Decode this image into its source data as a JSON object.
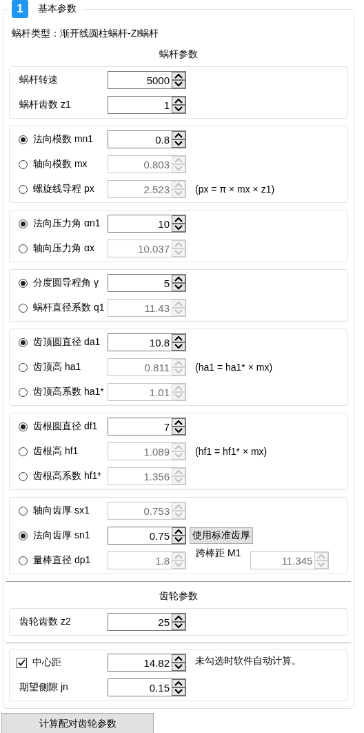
{
  "header": {
    "badge": "1",
    "title": "基本参数"
  },
  "worm_type": "蜗杆类型：渐开线圆柱蜗杆-ZI蜗杆",
  "sections": [
    {
      "title": "蜗杆参数",
      "groups": [
        {
          "rows": [
            {
              "kind": "plain",
              "label": "蜗杆转速",
              "value": "5000",
              "disabled": false
            },
            {
              "kind": "plain",
              "label": "蜗杆齿数 z1",
              "value": "1",
              "disabled": false
            }
          ]
        },
        {
          "rows": [
            {
              "kind": "radio",
              "selected": true,
              "label": "法向模数 mn1",
              "value": "0.8",
              "disabled": false
            },
            {
              "kind": "radio",
              "selected": false,
              "label": "轴向模数 mx",
              "value": "0.803",
              "disabled": true
            },
            {
              "kind": "radio",
              "selected": false,
              "label": "螺旋线导程 px",
              "value": "2.523",
              "disabled": true,
              "note": "(px = π × mx × z1)"
            }
          ]
        },
        {
          "rows": [
            {
              "kind": "radio",
              "selected": true,
              "label": "法向压力角 αn1",
              "value": "10",
              "disabled": false
            },
            {
              "kind": "radio",
              "selected": false,
              "label": "轴向压力角 αx",
              "value": "10.037",
              "disabled": true
            }
          ]
        },
        {
          "rows": [
            {
              "kind": "radio",
              "selected": true,
              "label": "分度圆导程角 γ",
              "value": "5",
              "disabled": false
            },
            {
              "kind": "radio",
              "selected": false,
              "label": "蜗杆直径系数 q1",
              "value": "11.43",
              "disabled": true
            }
          ]
        },
        {
          "rows": [
            {
              "kind": "radio",
              "selected": true,
              "label": "齿顶圆直径 da1",
              "value": "10.8",
              "disabled": false
            },
            {
              "kind": "radio",
              "selected": false,
              "label": "齿顶高 ha1",
              "value": "0.811",
              "disabled": true,
              "note": "(ha1 = ha1* × mx)"
            },
            {
              "kind": "radio",
              "selected": false,
              "label": "齿顶高系数 ha1*",
              "value": "1.01",
              "disabled": true
            }
          ]
        },
        {
          "rows": [
            {
              "kind": "radio",
              "selected": true,
              "label": "齿根圆直径 df1",
              "value": "7",
              "disabled": false
            },
            {
              "kind": "radio",
              "selected": false,
              "label": "齿根高 hf1",
              "value": "1.089",
              "disabled": true,
              "note": "(hf1 = hf1* × mx)"
            },
            {
              "kind": "radio",
              "selected": false,
              "label": "齿根高系数 hf1*",
              "value": "1.356",
              "disabled": true
            }
          ]
        },
        {
          "rows": [
            {
              "kind": "radio",
              "selected": false,
              "label": "轴向齿厚 sx1",
              "value": "0.753",
              "disabled": true
            },
            {
              "kind": "radio",
              "selected": true,
              "label": "法向齿厚 sn1",
              "value": "0.75",
              "disabled": false,
              "button": "使用标准齿厚"
            },
            {
              "kind": "radio",
              "selected": false,
              "label": "量棒直径 dp1",
              "value": "1.8",
              "disabled": true,
              "extra": {
                "label": "跨棒距 M1",
                "value": "11.345",
                "disabled": true
              }
            }
          ]
        }
      ]
    },
    {
      "title": "齿轮参数",
      "groups": [
        {
          "rows": [
            {
              "kind": "plain",
              "label": "齿轮齿数 z2",
              "value": "25",
              "disabled": false
            }
          ]
        }
      ]
    },
    {
      "groups": [
        {
          "rows": [
            {
              "kind": "check",
              "checked": true,
              "label": "中心距",
              "value": "14.82",
              "disabled": false,
              "note": "未勾选时软件自动计算。"
            },
            {
              "kind": "plain",
              "label": "期望侧隙 jn",
              "value": "0.15",
              "disabled": false
            }
          ]
        }
      ]
    }
  ],
  "calc_button": "计算配对齿轮参数"
}
